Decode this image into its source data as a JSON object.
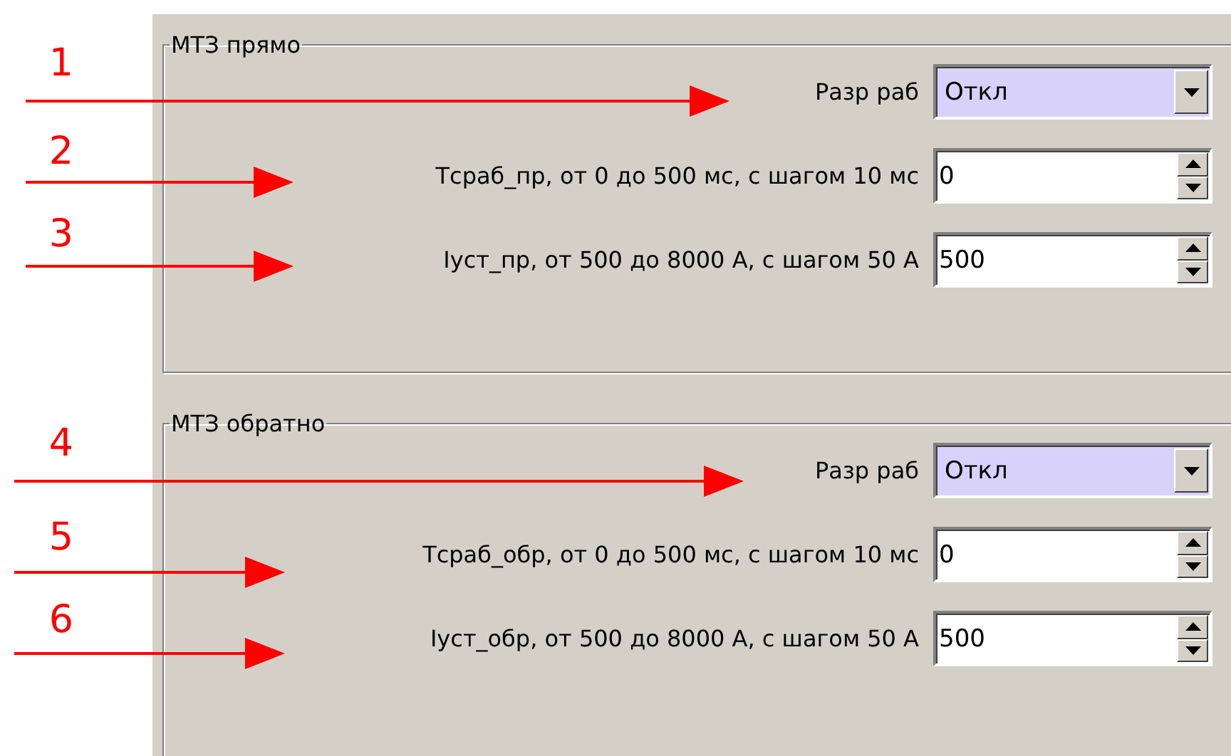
{
  "groups": [
    {
      "title": "МТЗ прямо",
      "rows": [
        {
          "kind": "combo",
          "label": "Разр раб",
          "value": "Откл"
        },
        {
          "kind": "spin",
          "label": "Тсраб_пр, от 0 до 500 мс, с шагом 10 мс",
          "value": "0"
        },
        {
          "kind": "spin",
          "label": "Iуст_пр, от 500 до 8000 А, с шагом 50 А",
          "value": "500"
        }
      ]
    },
    {
      "title": "МТЗ обратно",
      "rows": [
        {
          "kind": "combo",
          "label": "Разр раб",
          "value": "Откл"
        },
        {
          "kind": "spin",
          "label": "Тсраб_обр, от 0 до 500 мс, с шагом 10 мс",
          "value": "0"
        },
        {
          "kind": "spin",
          "label": "Iуст_обр, от 500 до 8000 А, с шагом 50 А",
          "value": "500"
        }
      ]
    }
  ],
  "annotations": [
    {
      "number": "1"
    },
    {
      "number": "2"
    },
    {
      "number": "3"
    },
    {
      "number": "4"
    },
    {
      "number": "5"
    },
    {
      "number": "6"
    }
  ]
}
